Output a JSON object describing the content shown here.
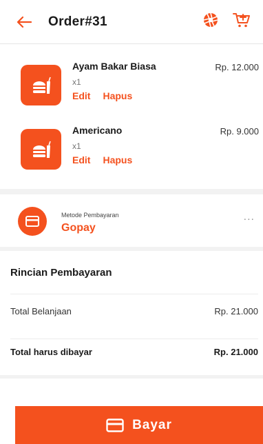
{
  "header": {
    "title": "Order#31",
    "back_icon": "arrow-left-icon",
    "icons": [
      "camera-aperture-icon",
      "add-to-cart-icon"
    ],
    "accent": "#f4511e"
  },
  "items": [
    {
      "name": "Ayam Bakar Biasa",
      "qty": "x1",
      "edit": "Edit",
      "delete": "Hapus",
      "price": "Rp. 12.000"
    },
    {
      "name": "Americano",
      "qty": "x1",
      "edit": "Edit",
      "delete": "Hapus",
      "price": "Rp. 9.000"
    }
  ],
  "payment": {
    "label": "Metode Pembayaran",
    "method": "Gopay",
    "more": "..."
  },
  "summary": {
    "title": "Rincian Pembayaran",
    "subtotal_label": "Total Belanjaan",
    "subtotal_value": "Rp. 21.000",
    "total_label": "Total harus dibayar",
    "total_value": "Rp. 21.000"
  },
  "action": {
    "pay_label": "Bayar"
  }
}
